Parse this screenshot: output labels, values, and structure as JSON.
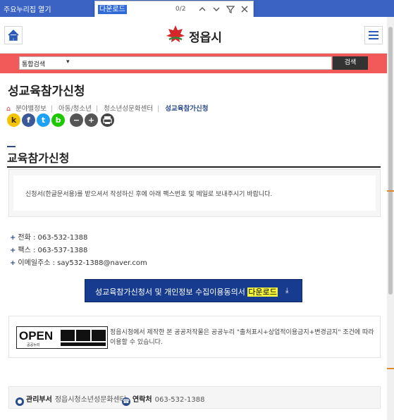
{
  "topbar": {
    "skip_link": "주요누리집 열기"
  },
  "findbar": {
    "query": "다운로드",
    "count": "0/2"
  },
  "header": {
    "logo_text": "정읍시"
  },
  "search": {
    "category": "통합검색",
    "button": "검색"
  },
  "page": {
    "title": "성교육참가신청"
  },
  "breadcrumb": {
    "items": [
      "분야별정보",
      "아동/청소년",
      "청소년성문화센터",
      "성교육참가신청"
    ]
  },
  "share": {
    "kakao": "k",
    "facebook": "f",
    "twitter": "t",
    "band": "b"
  },
  "section": {
    "title": "교육참가신청"
  },
  "notice": {
    "text": "신청서(한글문서용)를 받으셔서 작성하신 후에 아래 팩스번호 및 메일로 보내주시기 바랍니다."
  },
  "contacts": [
    {
      "label": "전화 : 063-532-1388"
    },
    {
      "label": "팩스 : 063-537-1388"
    },
    {
      "label": "이메일주소 : say532-1388@naver.com"
    }
  ],
  "download": {
    "prefix": "성교육참가신청서 및 개인정보 수집이용동의서 ",
    "highlight": "다운로드"
  },
  "open_license": {
    "logo": "OPEN",
    "sub": "공공누리",
    "text": "정읍시청에서 제작한 본 공공저작물은 공공누리 \"출처표시+상업적이용금지+변경금지\" 조건에 따라 이용할 수 있습니다."
  },
  "footer": {
    "dept_label": "관리부서",
    "dept_value": "정읍시청소년성문화센터",
    "contact_label": "연락처",
    "contact_value": "063-532-1388"
  },
  "colors": {
    "accent": "#173c8f",
    "search_bar": "#f25a5a",
    "topbar": "#3a63c4",
    "highlight": "#f5f53b"
  }
}
